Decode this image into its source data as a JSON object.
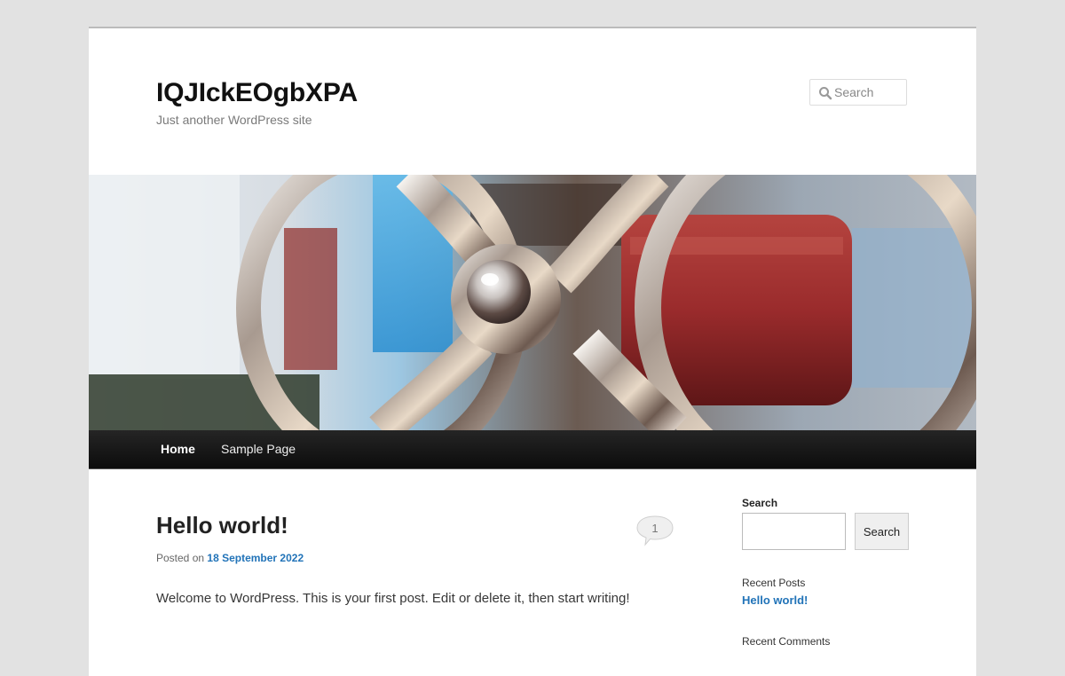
{
  "site": {
    "title": "IQJIckEOgbXPA",
    "tagline": "Just another WordPress site"
  },
  "header_search": {
    "placeholder": "Search",
    "icon": "search-icon"
  },
  "nav": {
    "items": [
      {
        "label": "Home",
        "active": true
      },
      {
        "label": "Sample Page",
        "active": false
      }
    ]
  },
  "post": {
    "title": "Hello world!",
    "comment_count": "1",
    "meta_prefix": "Posted on",
    "date": "18 September 2022",
    "content": "Welcome to WordPress. This is your first post. Edit or delete it, then start writing!"
  },
  "sidebar": {
    "search_label": "Search",
    "search_button": "Search",
    "recent_posts_title": "Recent Posts",
    "recent_posts": [
      "Hello world!"
    ],
    "recent_comments_title": "Recent Comments"
  },
  "colors": {
    "link": "#2173b8",
    "nav_bg": "#151515",
    "page_bg": "#e2e2e2"
  }
}
